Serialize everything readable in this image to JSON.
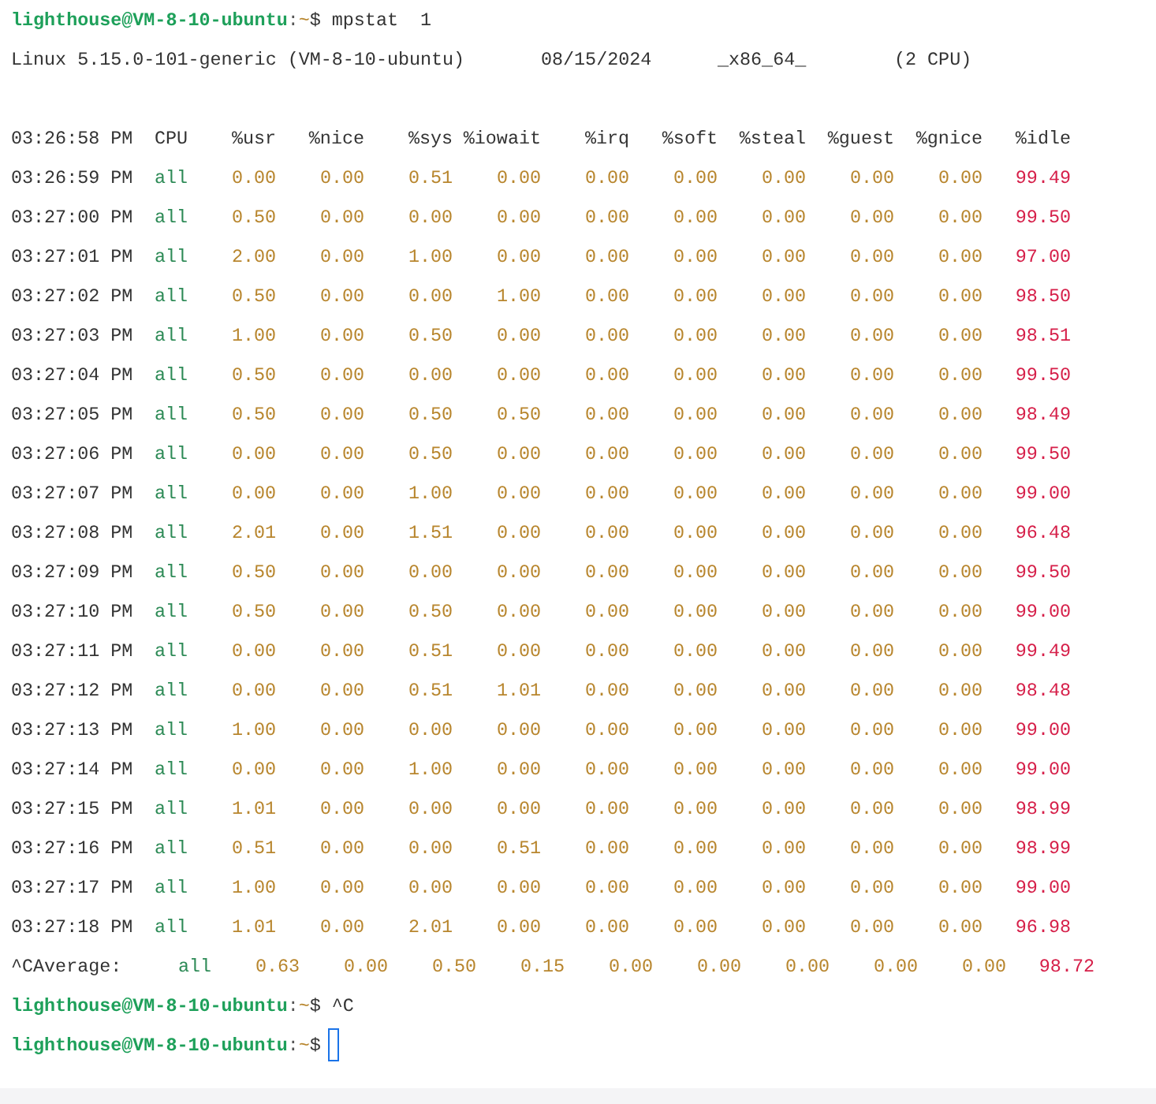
{
  "first_prompt": {
    "user_host": "lighthouse@VM-8-10-ubuntu",
    "separator": ":",
    "path": "~",
    "symbol": "$",
    "command": "mpstat  1",
    "cursor": false
  },
  "system_info": [
    "Linux 5.15.0-101-generic (VM-8-10-ubuntu)",
    "08/15/2024",
    "_x86_64_",
    "(2 CPU)"
  ],
  "table": {
    "columns": [
      "03:26:58 PM",
      "CPU",
      "%usr",
      "%nice",
      "%sys",
      "%iowait",
      "%irq",
      "%soft",
      "%steal",
      "%guest",
      "%gnice",
      "%idle"
    ],
    "rows": [
      [
        "03:26:59 PM",
        "all",
        "0.00",
        "0.00",
        "0.51",
        "0.00",
        "0.00",
        "0.00",
        "0.00",
        "0.00",
        "0.00",
        "99.49"
      ],
      [
        "03:27:00 PM",
        "all",
        "0.50",
        "0.00",
        "0.00",
        "0.00",
        "0.00",
        "0.00",
        "0.00",
        "0.00",
        "0.00",
        "99.50"
      ],
      [
        "03:27:01 PM",
        "all",
        "2.00",
        "0.00",
        "1.00",
        "0.00",
        "0.00",
        "0.00",
        "0.00",
        "0.00",
        "0.00",
        "97.00"
      ],
      [
        "03:27:02 PM",
        "all",
        "0.50",
        "0.00",
        "0.00",
        "1.00",
        "0.00",
        "0.00",
        "0.00",
        "0.00",
        "0.00",
        "98.50"
      ],
      [
        "03:27:03 PM",
        "all",
        "1.00",
        "0.00",
        "0.50",
        "0.00",
        "0.00",
        "0.00",
        "0.00",
        "0.00",
        "0.00",
        "98.51"
      ],
      [
        "03:27:04 PM",
        "all",
        "0.50",
        "0.00",
        "0.00",
        "0.00",
        "0.00",
        "0.00",
        "0.00",
        "0.00",
        "0.00",
        "99.50"
      ],
      [
        "03:27:05 PM",
        "all",
        "0.50",
        "0.00",
        "0.50",
        "0.50",
        "0.00",
        "0.00",
        "0.00",
        "0.00",
        "0.00",
        "98.49"
      ],
      [
        "03:27:06 PM",
        "all",
        "0.00",
        "0.00",
        "0.50",
        "0.00",
        "0.00",
        "0.00",
        "0.00",
        "0.00",
        "0.00",
        "99.50"
      ],
      [
        "03:27:07 PM",
        "all",
        "0.00",
        "0.00",
        "1.00",
        "0.00",
        "0.00",
        "0.00",
        "0.00",
        "0.00",
        "0.00",
        "99.00"
      ],
      [
        "03:27:08 PM",
        "all",
        "2.01",
        "0.00",
        "1.51",
        "0.00",
        "0.00",
        "0.00",
        "0.00",
        "0.00",
        "0.00",
        "96.48"
      ],
      [
        "03:27:09 PM",
        "all",
        "0.50",
        "0.00",
        "0.00",
        "0.00",
        "0.00",
        "0.00",
        "0.00",
        "0.00",
        "0.00",
        "99.50"
      ],
      [
        "03:27:10 PM",
        "all",
        "0.50",
        "0.00",
        "0.50",
        "0.00",
        "0.00",
        "0.00",
        "0.00",
        "0.00",
        "0.00",
        "99.00"
      ],
      [
        "03:27:11 PM",
        "all",
        "0.00",
        "0.00",
        "0.51",
        "0.00",
        "0.00",
        "0.00",
        "0.00",
        "0.00",
        "0.00",
        "99.49"
      ],
      [
        "03:27:12 PM",
        "all",
        "0.00",
        "0.00",
        "0.51",
        "1.01",
        "0.00",
        "0.00",
        "0.00",
        "0.00",
        "0.00",
        "98.48"
      ],
      [
        "03:27:13 PM",
        "all",
        "1.00",
        "0.00",
        "0.00",
        "0.00",
        "0.00",
        "0.00",
        "0.00",
        "0.00",
        "0.00",
        "99.00"
      ],
      [
        "03:27:14 PM",
        "all",
        "0.00",
        "0.00",
        "1.00",
        "0.00",
        "0.00",
        "0.00",
        "0.00",
        "0.00",
        "0.00",
        "99.00"
      ],
      [
        "03:27:15 PM",
        "all",
        "1.01",
        "0.00",
        "0.00",
        "0.00",
        "0.00",
        "0.00",
        "0.00",
        "0.00",
        "0.00",
        "98.99"
      ],
      [
        "03:27:16 PM",
        "all",
        "0.51",
        "0.00",
        "0.00",
        "0.51",
        "0.00",
        "0.00",
        "0.00",
        "0.00",
        "0.00",
        "98.99"
      ],
      [
        "03:27:17 PM",
        "all",
        "1.00",
        "0.00",
        "0.00",
        "0.00",
        "0.00",
        "0.00",
        "0.00",
        "0.00",
        "0.00",
        "99.00"
      ],
      [
        "03:27:18 PM",
        "all",
        "1.01",
        "0.00",
        "2.01",
        "0.00",
        "0.00",
        "0.00",
        "0.00",
        "0.00",
        "0.00",
        "96.98"
      ]
    ],
    "average": [
      "^CAverage:",
      "all",
      "0.63",
      "0.00",
      "0.50",
      "0.15",
      "0.00",
      "0.00",
      "0.00",
      "0.00",
      "0.00",
      "98.72"
    ]
  },
  "later_prompts": [
    {
      "user_host": "lighthouse@VM-8-10-ubuntu",
      "separator": ":",
      "path": "~",
      "symbol": "$",
      "command": "^C",
      "cursor": false
    },
    {
      "user_host": "lighthouse@VM-8-10-ubuntu",
      "separator": ":",
      "path": "~",
      "symbol": "$",
      "cursor": true
    }
  ]
}
